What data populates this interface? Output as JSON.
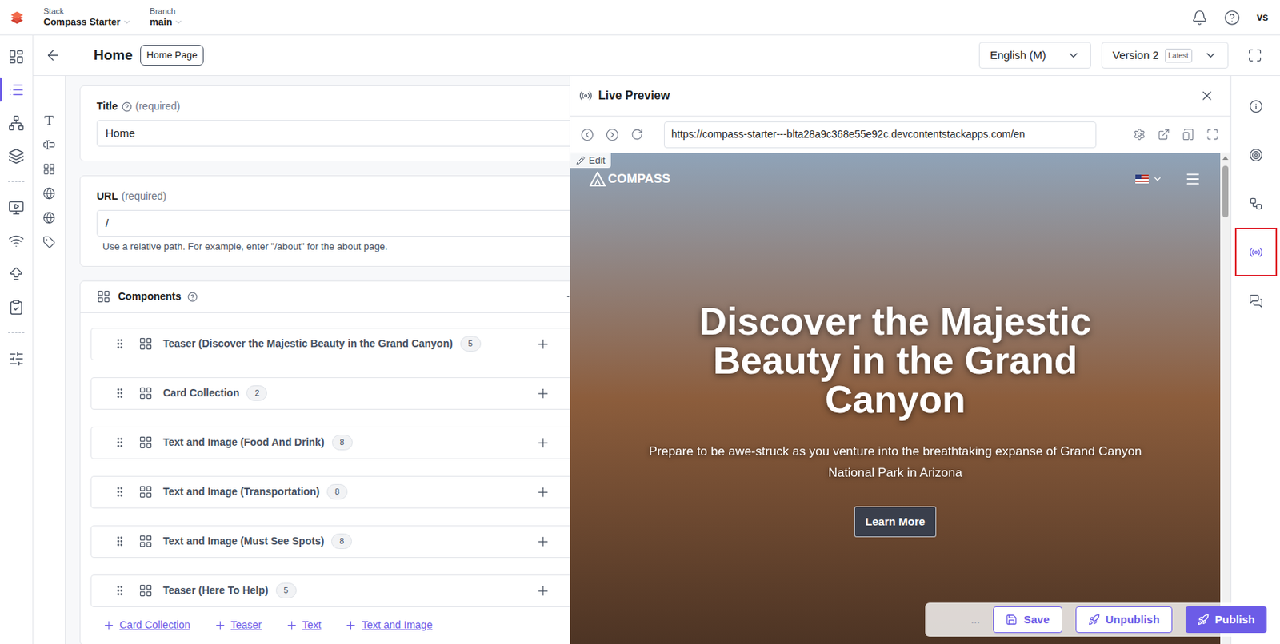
{
  "header": {
    "stack_label": "Stack",
    "stack_name": "Compass Starter",
    "branch_label": "Branch",
    "branch_name": "main",
    "user_initials": "vs"
  },
  "nav_rail": [
    {
      "selected": false
    },
    {
      "selected": true
    },
    {
      "selected": false
    },
    {
      "selected": false
    },
    {
      "selected": false
    },
    {
      "selected": false
    },
    {
      "selected": false
    },
    {
      "selected": false
    },
    {
      "selected": false
    }
  ],
  "entry": {
    "title": "Home",
    "content_type": "Home Page",
    "locale": "English (M)",
    "version": "Version 2",
    "version_badge": "Latest"
  },
  "fields": {
    "title": {
      "label": "Title",
      "required": "(required)",
      "value": "Home"
    },
    "url": {
      "label": "URL",
      "required": "(required)",
      "value": "/",
      "help": "Use a relative path. For example, enter \"/about\" for the about page."
    },
    "components": {
      "label": "Components",
      "rows": [
        {
          "name": "Teaser (Discover the Majestic Beauty in the Grand Canyon)",
          "count": "5"
        },
        {
          "name": "Card Collection",
          "count": "2"
        },
        {
          "name": "Text and Image (Food And Drink)",
          "count": "8"
        },
        {
          "name": "Text and Image (Transportation)",
          "count": "8"
        },
        {
          "name": "Text and Image (Must See Spots)",
          "count": "8"
        },
        {
          "name": "Teaser (Here To Help)",
          "count": "5"
        }
      ],
      "add_buttons": [
        "Card Collection",
        "Teaser",
        "Text",
        "Text and Image"
      ]
    }
  },
  "preview": {
    "title": "Live Preview",
    "url": "https://compass-starter---blta28a9c368e55e92c.devcontentstackapps.com/en",
    "edit": "Edit",
    "site": {
      "logo": "COMPASS",
      "heading": "Discover the Majestic Beauty in the Grand Canyon",
      "subtext": "Prepare to be awe-struck as you venture into the breathtaking expanse of Grand Canyon National Park in Arizona",
      "button": "Learn More"
    }
  },
  "right_rail": [
    {
      "selected": false
    },
    {
      "selected": false
    },
    {
      "selected": false
    },
    {
      "selected": true
    },
    {
      "selected": false
    }
  ],
  "actions": {
    "more": "...",
    "save": "Save",
    "unpublish": "Unpublish",
    "publish": "Publish"
  }
}
